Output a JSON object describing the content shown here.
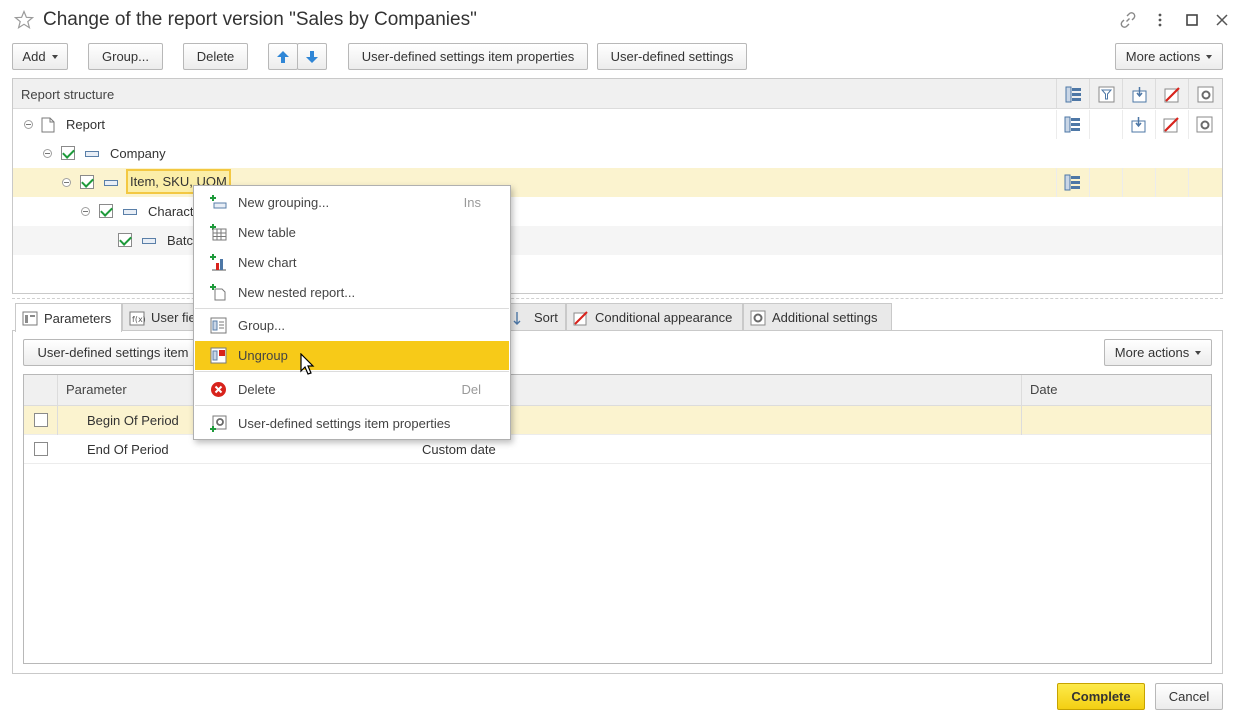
{
  "window": {
    "title": "Change of the report version \"Sales by Companies\"",
    "icons": [
      "star-icon",
      "link-icon",
      "kebab-menu-icon",
      "maximize-icon",
      "close-icon"
    ]
  },
  "toolbar": {
    "add": "Add",
    "group": "Group...",
    "delete": "Delete",
    "move_up_icon": "arrow-up-icon",
    "move_down_icon": "arrow-down-icon",
    "item_properties": "User-defined settings item properties",
    "user_settings": "User-defined settings",
    "more_actions": "More actions"
  },
  "structure": {
    "header": "Report structure",
    "column_icons": [
      "groupings-icon",
      "filter-icon",
      "selected-fields-icon",
      "conditional-appearance-icon",
      "settings-icon"
    ],
    "rows": [
      {
        "label": "Report",
        "checked": null
      },
      {
        "label": "Company",
        "checked": true
      },
      {
        "label": "Item, SKU, UOM",
        "checked": true,
        "selected": true
      },
      {
        "label": "Charact",
        "checked": true
      },
      {
        "label": "Batc",
        "checked": true
      }
    ]
  },
  "tabs": [
    {
      "label": "Parameters",
      "active": true
    },
    {
      "label": "User fie"
    },
    {
      "label": "Sort"
    },
    {
      "label": "Conditional appearance"
    },
    {
      "label": "Additional settings"
    }
  ],
  "parameters": {
    "toolbar_button": "User-defined settings item",
    "more_actions": "More actions",
    "columns": [
      "Parameter",
      "Date"
    ],
    "rows": [
      {
        "checked": false,
        "name": "Begin Of Period",
        "value": "",
        "date": "",
        "selected": true
      },
      {
        "checked": false,
        "name": "End Of Period",
        "value": "Custom date",
        "date": ""
      }
    ]
  },
  "context_menu": {
    "items": [
      {
        "label": "New grouping...",
        "shortcut": "Ins",
        "icon": "new-grouping-icon"
      },
      {
        "label": "New table",
        "shortcut": "",
        "icon": "new-table-icon"
      },
      {
        "label": "New chart",
        "shortcut": "",
        "icon": "new-chart-icon"
      },
      {
        "label": "New nested report...",
        "shortcut": "",
        "icon": "new-nested-report-icon"
      },
      {
        "label": "Group...",
        "shortcut": "",
        "icon": "group-icon"
      },
      {
        "label": "Ungroup",
        "shortcut": "",
        "icon": "ungroup-icon",
        "highlighted": true
      },
      {
        "label": "Delete",
        "shortcut": "Del",
        "icon": "delete-icon"
      },
      {
        "label": "User-defined settings item properties",
        "shortcut": "",
        "icon": "item-properties-icon"
      }
    ]
  },
  "footer": {
    "complete": "Complete",
    "cancel": "Cancel"
  },
  "colors": {
    "selection_row": "#fbf3cf",
    "menu_highlight": "#f7ca18",
    "primary_button": "#f3cf13",
    "check_green": "#1d9a3a"
  }
}
